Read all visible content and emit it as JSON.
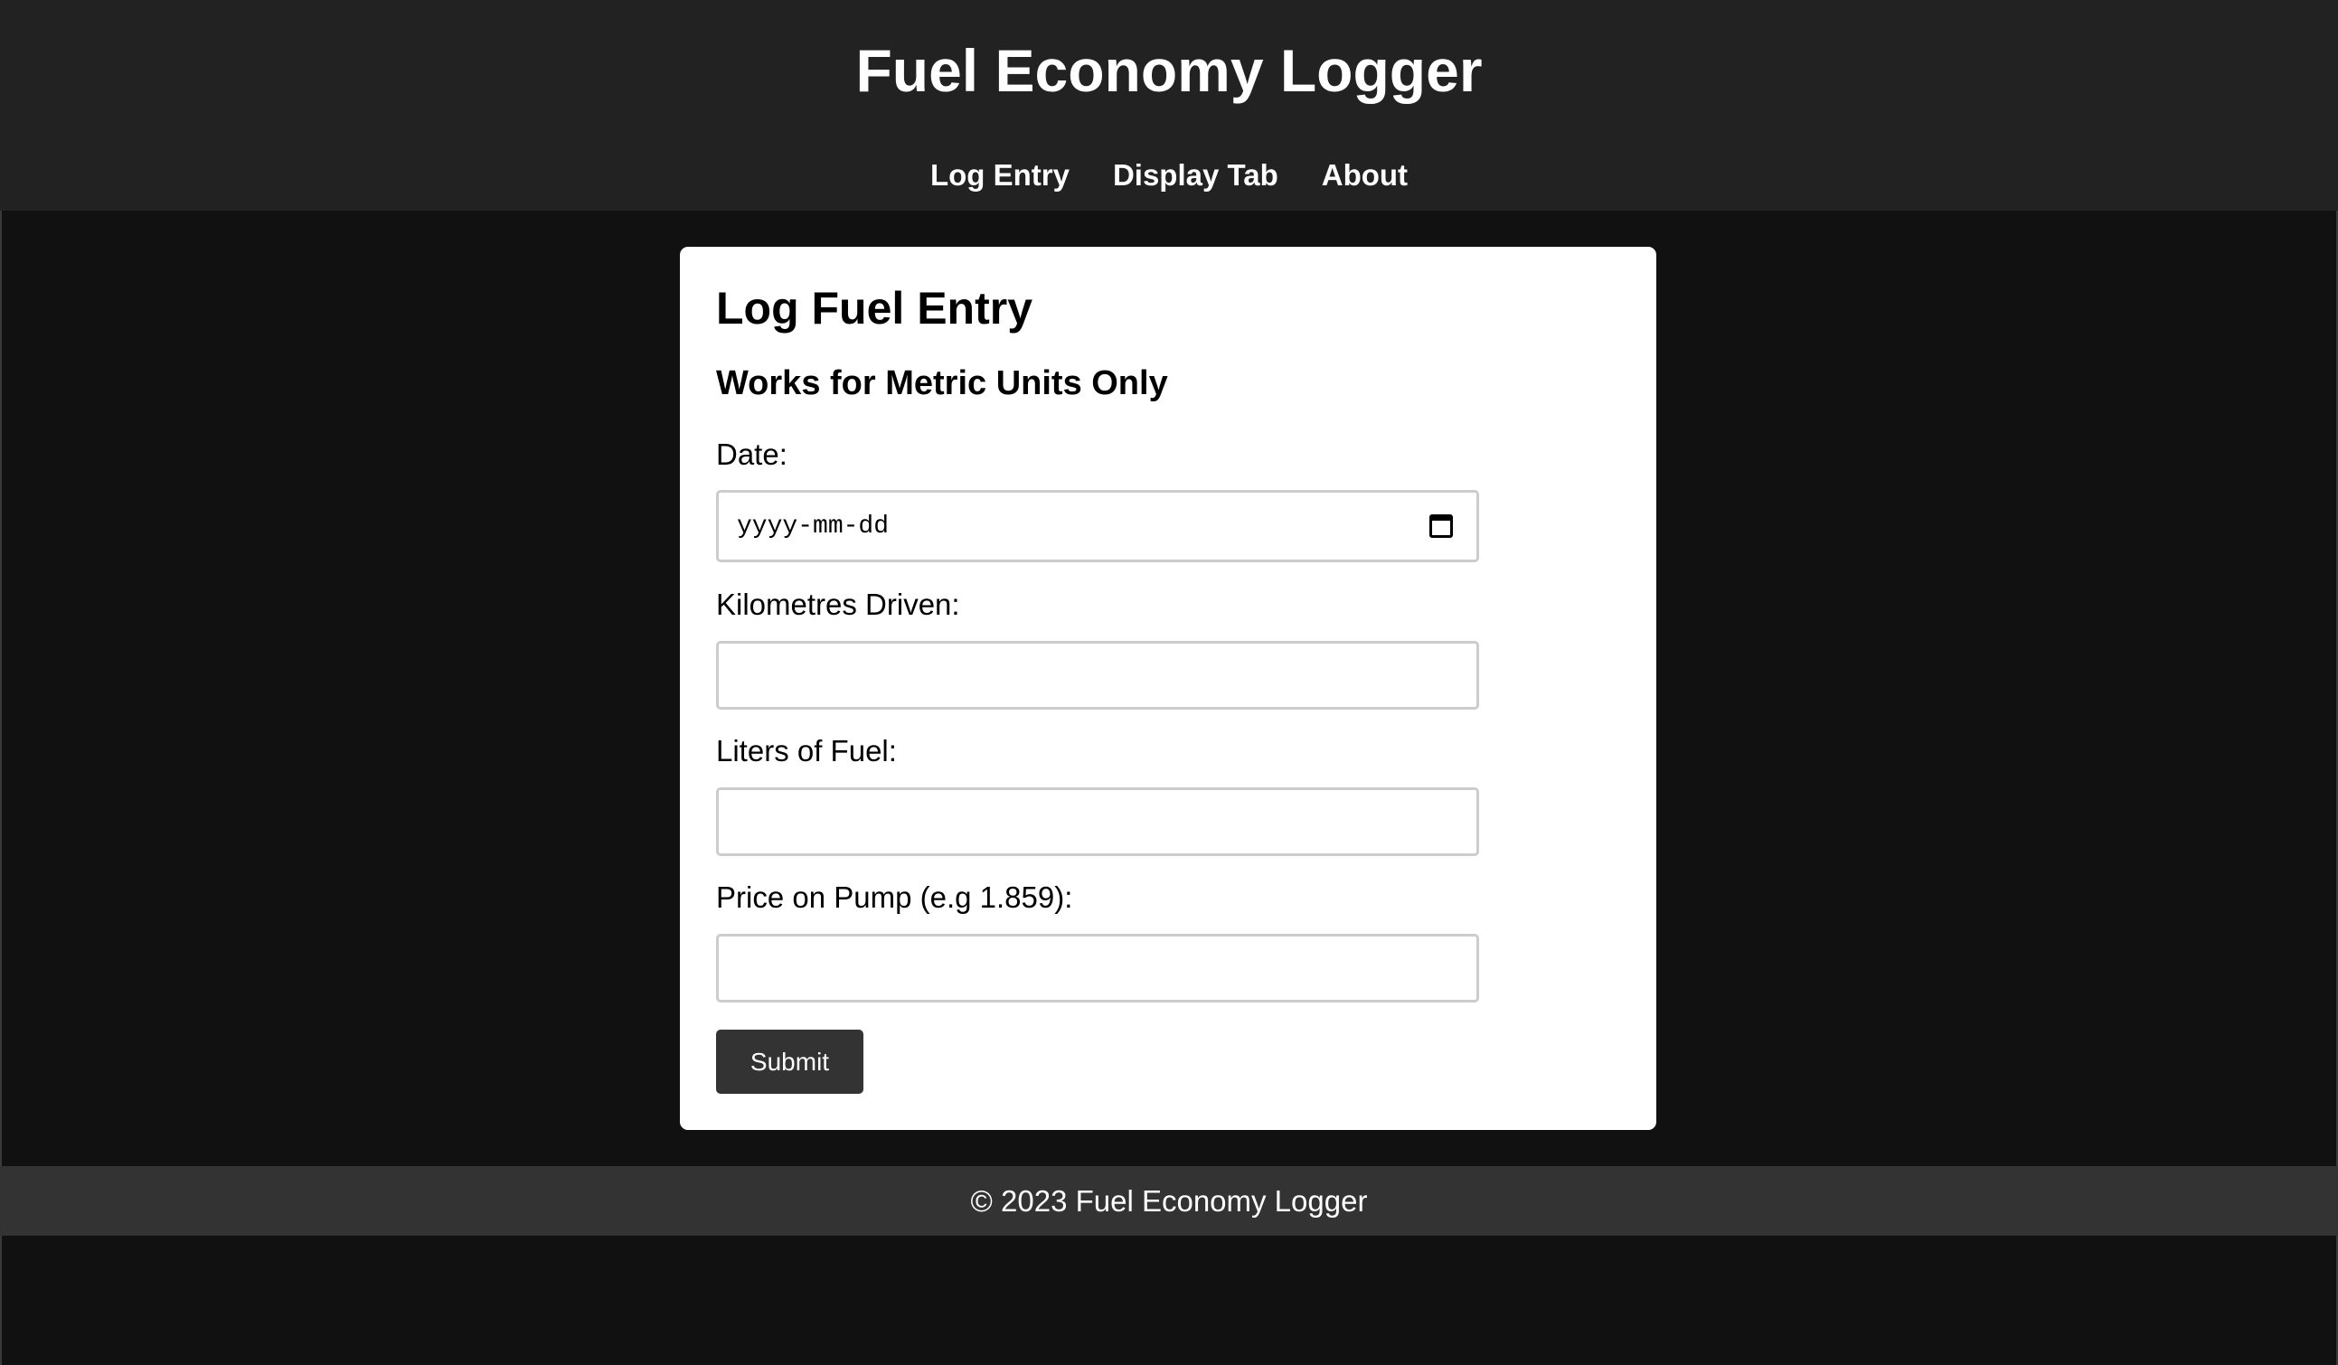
{
  "header": {
    "title": "Fuel Economy Logger",
    "nav": [
      {
        "label": "Log Entry"
      },
      {
        "label": "Display Tab"
      },
      {
        "label": "About"
      }
    ]
  },
  "form": {
    "heading": "Log Fuel Entry",
    "subheading": "Works for Metric Units Only",
    "date_label": "Date:",
    "date_placeholder": "yyyy-mm-dd",
    "date_value": "",
    "km_label": "Kilometres Driven:",
    "km_value": "",
    "liters_label": "Liters of Fuel:",
    "liters_value": "",
    "price_label": "Price on Pump (e.g 1.859):",
    "price_value": "",
    "submit_label": "Submit",
    "icons": {
      "date_picker": "calendar-icon"
    }
  },
  "footer": {
    "text": "© 2023 Fuel Economy Logger"
  },
  "colors": {
    "background": "#111111",
    "header_bg": "#222222",
    "footer_bg": "#333333",
    "card_bg": "#ffffff",
    "button_bg": "#333333"
  }
}
